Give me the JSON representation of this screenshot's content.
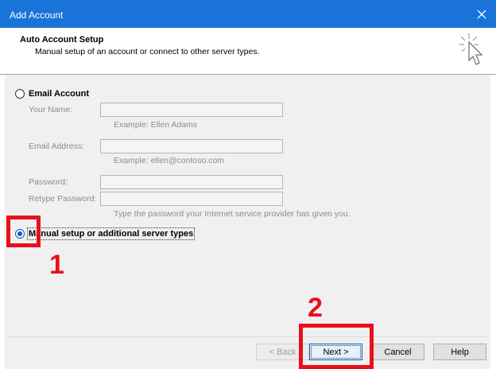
{
  "window": {
    "title": "Add Account"
  },
  "header": {
    "title": "Auto Account Setup",
    "subtitle": "Manual setup of an account or connect to other server types."
  },
  "email_account": {
    "label": "Email Account",
    "fields": {
      "name": {
        "label": "Your Name:",
        "hint": "Example: Ellen Adams",
        "value": ""
      },
      "email": {
        "label": "Email Address:",
        "hint": "Example: ellen@contoso.com",
        "value": ""
      },
      "password": {
        "label": "Password:",
        "value": ""
      },
      "retype": {
        "label": "Retype Password:",
        "value": ""
      },
      "password_hint": "Type the password your Internet service provider has given you."
    }
  },
  "manual_setup": {
    "label": "Manual setup or additional server types",
    "selected": true
  },
  "annotations": {
    "step1": "1",
    "step2": "2"
  },
  "buttons": {
    "back": "< Back",
    "next": "Next >",
    "cancel": "Cancel",
    "help": "Help"
  },
  "colors": {
    "titlebar": "#1a73d9",
    "annotation": "#e8101d",
    "radio_selected": "#0a5bc4"
  }
}
